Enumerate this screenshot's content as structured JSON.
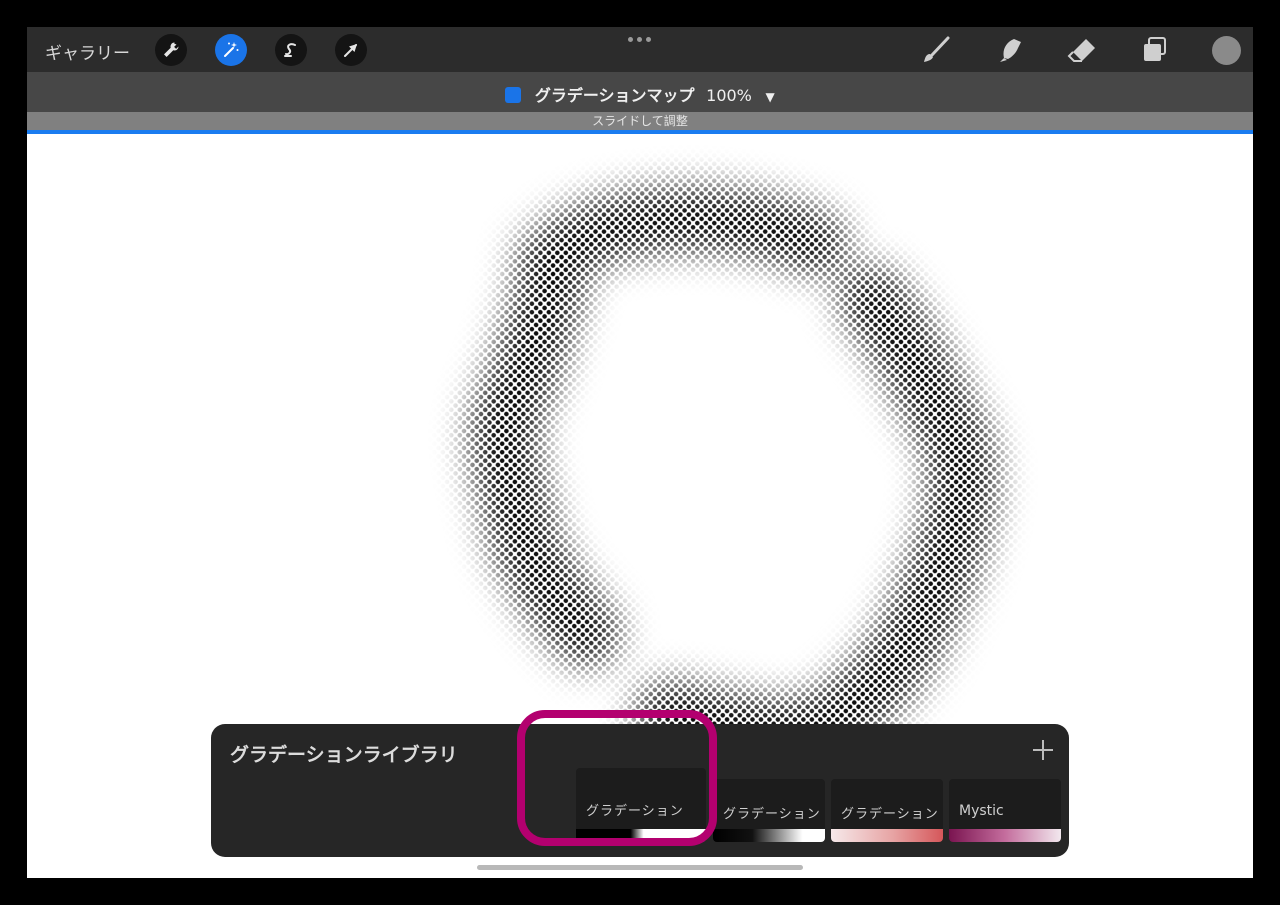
{
  "topbar": {
    "gallery_label": "ギャラリー",
    "tools": [
      {
        "name": "wrench-icon",
        "active": false
      },
      {
        "name": "magic-wand-icon",
        "active": true
      },
      {
        "name": "selection-icon",
        "active": false
      },
      {
        "name": "transform-arrow-icon",
        "active": false
      }
    ],
    "right_tools": [
      "brush-icon",
      "smudge-icon",
      "eraser-icon",
      "layers-icon"
    ],
    "color": "#8a8a8a"
  },
  "adjustment": {
    "title": "グラデーションマップ",
    "percent": "100%",
    "hint": "スライドして調整",
    "progress": 1.0
  },
  "library": {
    "title": "グラデーションライブラリ",
    "items": [
      {
        "label": "グラデーション",
        "selected": true,
        "gradient": "linear-gradient(90deg,#000 0%,#000 42%,#fff 52%,#fff 100%)"
      },
      {
        "label": "グラデーション",
        "selected": false,
        "gradient": "linear-gradient(90deg,#000 0%,#111 35%,#fff 80%,#fff 100%)"
      },
      {
        "label": "グラデーション",
        "selected": false,
        "gradient": "linear-gradient(90deg,#f6e9ea 0%,#e7a4a4 55%,#d5575a 100%)"
      },
      {
        "label": "Mystic",
        "selected": false,
        "gradient": "linear-gradient(90deg,#7a1450 0%,#c46d9d 50%,#f2e8ee 100%)"
      }
    ]
  },
  "colors": {
    "accent": "#1a74e8",
    "highlight": "#b3006f"
  }
}
